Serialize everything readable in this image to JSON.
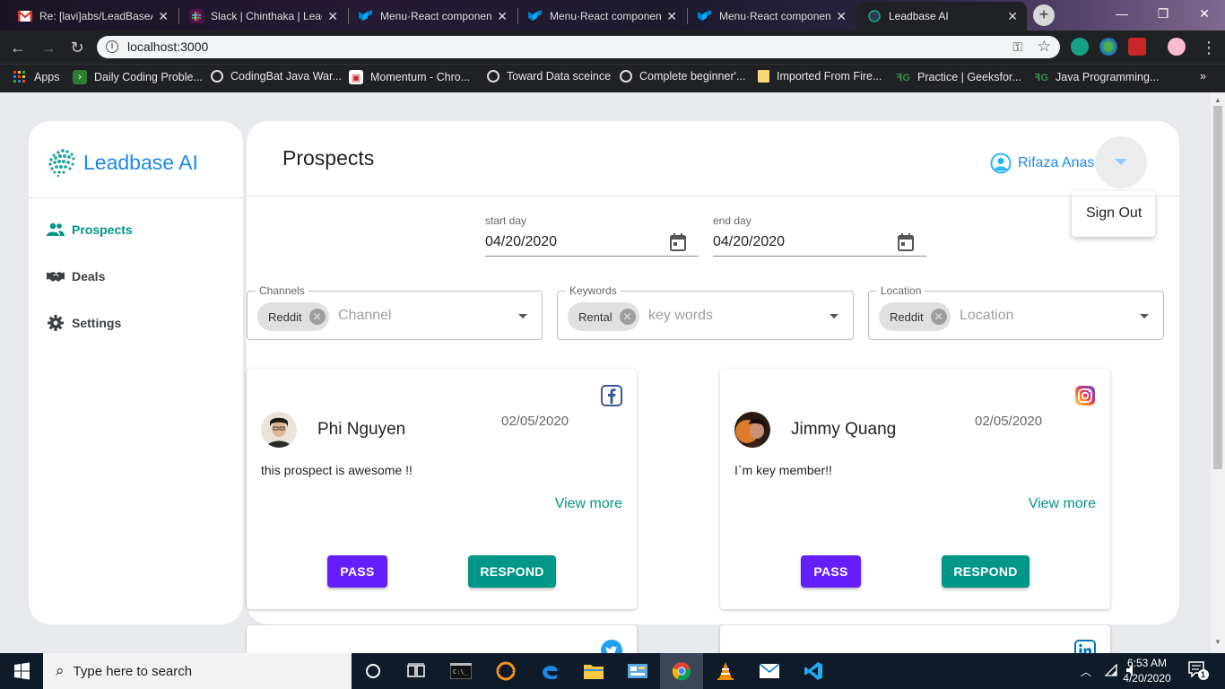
{
  "browser": {
    "tabs": [
      {
        "title": "Re: [lavi]abs/LeadBaseAI",
        "icon": "gmail-icon"
      },
      {
        "title": "Slack | Chinthaka | Lead",
        "icon": "slack-icon"
      },
      {
        "title": "Menu·React component",
        "icon": "material-ui-icon"
      },
      {
        "title": "Menu·React component",
        "icon": "material-ui-icon"
      },
      {
        "title": "Menu·React component",
        "icon": "material-ui-icon"
      },
      {
        "title": "Leadbase AI",
        "icon": "leadbase-icon",
        "active": true
      }
    ],
    "url": "localhost:3000",
    "bookmarks": [
      {
        "label": "Apps"
      },
      {
        "label": "Daily Coding Proble..."
      },
      {
        "label": "CodingBat Java War..."
      },
      {
        "label": "Momentum - Chro..."
      },
      {
        "label": "Toward Data sceince"
      },
      {
        "label": "Complete beginner'..."
      },
      {
        "label": "Imported From Fire..."
      },
      {
        "label": "Practice | Geeksfor..."
      },
      {
        "label": "Java Programming..."
      }
    ],
    "more_bookmarks": "»"
  },
  "app": {
    "brand": "Leadbase AI",
    "sidebar": {
      "items": [
        {
          "label": "Prospects",
          "icon": "people-icon",
          "active": true
        },
        {
          "label": "Deals",
          "icon": "handshake-icon"
        },
        {
          "label": "Settings",
          "icon": "gear-icon"
        }
      ]
    },
    "header": {
      "title": "Prospects",
      "user_name": "Rifaza Anas",
      "menu_item": "Sign Out"
    },
    "dates": {
      "start_label": "start day",
      "start_value": "04/20/2020",
      "end_label": "end day",
      "end_value": "04/20/2020"
    },
    "filters": [
      {
        "label": "Channels",
        "chip": "Reddit",
        "placeholder": "Channel"
      },
      {
        "label": "Keywords",
        "chip": "Rental",
        "placeholder": "key words"
      },
      {
        "label": "Location",
        "chip": "Reddit",
        "placeholder": "Location"
      }
    ],
    "cards": [
      {
        "name": "Phi Nguyen",
        "date": "02/05/2020",
        "text": "this prospect is awesome !!",
        "social": "facebook-icon",
        "more": "View more",
        "pass": "PASS",
        "respond": "RESPOND"
      },
      {
        "name": "Jimmy Quang",
        "date": "02/05/2020",
        "text": "I`m key member!!",
        "social": "instagram-icon",
        "more": "View more",
        "pass": "PASS",
        "respond": "RESPOND"
      },
      {
        "social": "twitter-icon"
      },
      {
        "social": "linkedin-icon"
      }
    ],
    "colors": {
      "accent": "#009688",
      "brand": "#1e88e5",
      "pass": "#651fff"
    }
  },
  "taskbar": {
    "search_placeholder": "Type here to search",
    "time": "6:53 AM",
    "date": "4/20/2020",
    "notifications": "1"
  }
}
